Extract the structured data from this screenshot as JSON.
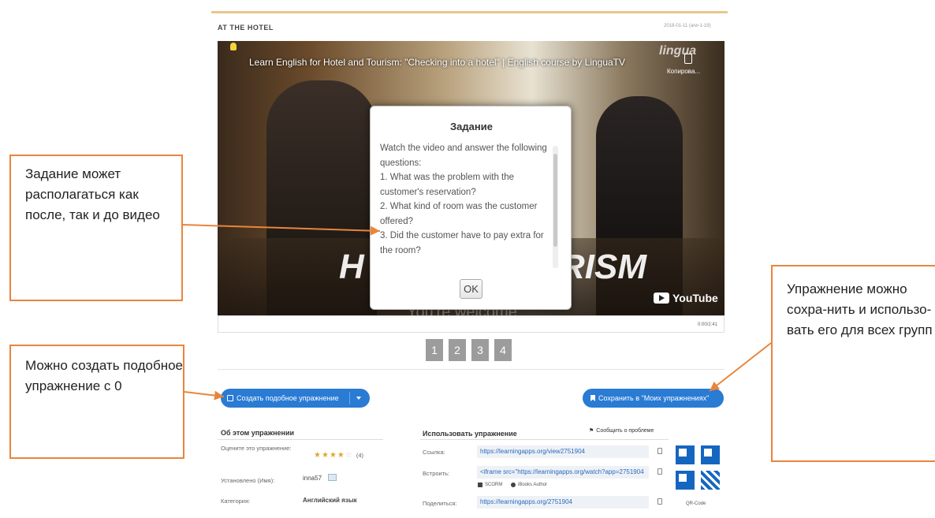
{
  "exercise": {
    "title": "AT THE HOTEL",
    "date": "2018-01-11 (arw-1-19)"
  },
  "video": {
    "title": "Learn English for Hotel and Tourism: \"Checking into a hotel\" | English course by LinguaTV",
    "brand": "lingua",
    "copy_label": "Копирова...",
    "overlay_left": "H",
    "overlay_right": "RISM",
    "subtitle": "You're welcome",
    "youtube_label": "YouTube",
    "time": "0:00/2:41"
  },
  "modal": {
    "title": "Задание",
    "lines": [
      "Watch the video and answer the following",
      "questions:",
      "1. What was the problem with the",
      "customer's reservation?",
      "2. What kind of room was the customer",
      "offered?",
      "3. Did the customer have to pay extra for",
      "the room?"
    ],
    "ok_label": "OK"
  },
  "pager": [
    "1",
    "2",
    "3",
    "4"
  ],
  "buttons": {
    "create": "Создать подобное упражнение",
    "save": "Сохранить в \"Моих упражнениях\""
  },
  "about": {
    "heading": "Об этом упражнении",
    "rate_label": "Оцените это упражнение:",
    "rating": 4,
    "rating_count": "(4)",
    "installed_label": "Установлено (Имя):",
    "installed_value": "inna57",
    "category_label": "Категория:",
    "category_value": "Английский язык"
  },
  "use": {
    "heading": "Использовать упражнение",
    "report": "Сообщить о проблеме",
    "link_label": "Ссылка:",
    "link_value": "https://learningapps.org/view2751904",
    "embed_label": "Встроить:",
    "embed_value": "<iframe src=\"https://learningapps.org/watch?app=2751904",
    "scorm": "SCORM",
    "ibooks": "iBooks Author",
    "share_label": "Поделиться:",
    "share_value": "https://learningapps.org/2751904",
    "qr_label": "QR-Code"
  },
  "notes": {
    "note1": "Задание может располагаться как после, так и до видео",
    "note2": "Можно создать подобное упражнение с 0",
    "note3": "Упражнение можно сохра-нить и использо-вать его для всех групп"
  },
  "colors": {
    "accent": "#2a7bd3",
    "annotation": "#e8853c",
    "pager": "#9c9c9c"
  }
}
